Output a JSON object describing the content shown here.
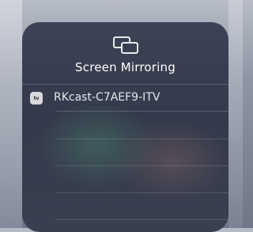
{
  "panel": {
    "title": "Screen Mirroring",
    "header_icon": "screen-mirroring-icon"
  },
  "devices": [
    {
      "name": "RKcast-C7AEF9-ITV",
      "icon": "apple-tv-icon",
      "badge_text": "tv"
    }
  ]
}
